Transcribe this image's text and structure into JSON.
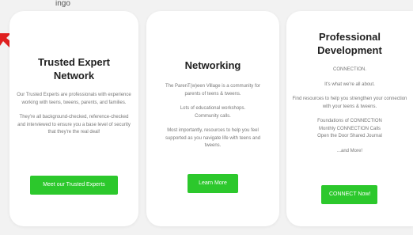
{
  "page": {
    "top_fragment": "ingo"
  },
  "cards": [
    {
      "title": "Trusted Expert Network",
      "paragraphs": [
        "Our Trusted Experts are professionals with experience working with teens, tweens, parents, and families.",
        "They're all background-checked, reference-checked and interviewed to ensure you a base level of security that they're the real deal!"
      ],
      "button": "Meet our Trusted Experts"
    },
    {
      "title": "Networking",
      "paragraphs": [
        "The ParenT(w)een Village is a community for parents of teens & tweens.",
        "Lots of educational workshops. Community calls.",
        "Most importantly, resources to help you feel supported as you navigate life with teens and tweens."
      ],
      "button": "Learn More"
    },
    {
      "title": "Professional Development",
      "paragraphs": [
        "CONNECTION.",
        "It's what we're all about.",
        "Find resources to help you strengthen your connection with your teens & tweens.",
        "Foundations of CONNECTION",
        "Monthly CONNECTION Calls",
        "Open the Door Shared Journal",
        "...and More!"
      ],
      "button": "CONNECT Now!"
    }
  ],
  "colors": {
    "button_green": "#2cc82c",
    "arrow_red": "#e02020",
    "background": "#f2f2f2"
  },
  "icons": {
    "arrow": "red-arrow-icon"
  }
}
